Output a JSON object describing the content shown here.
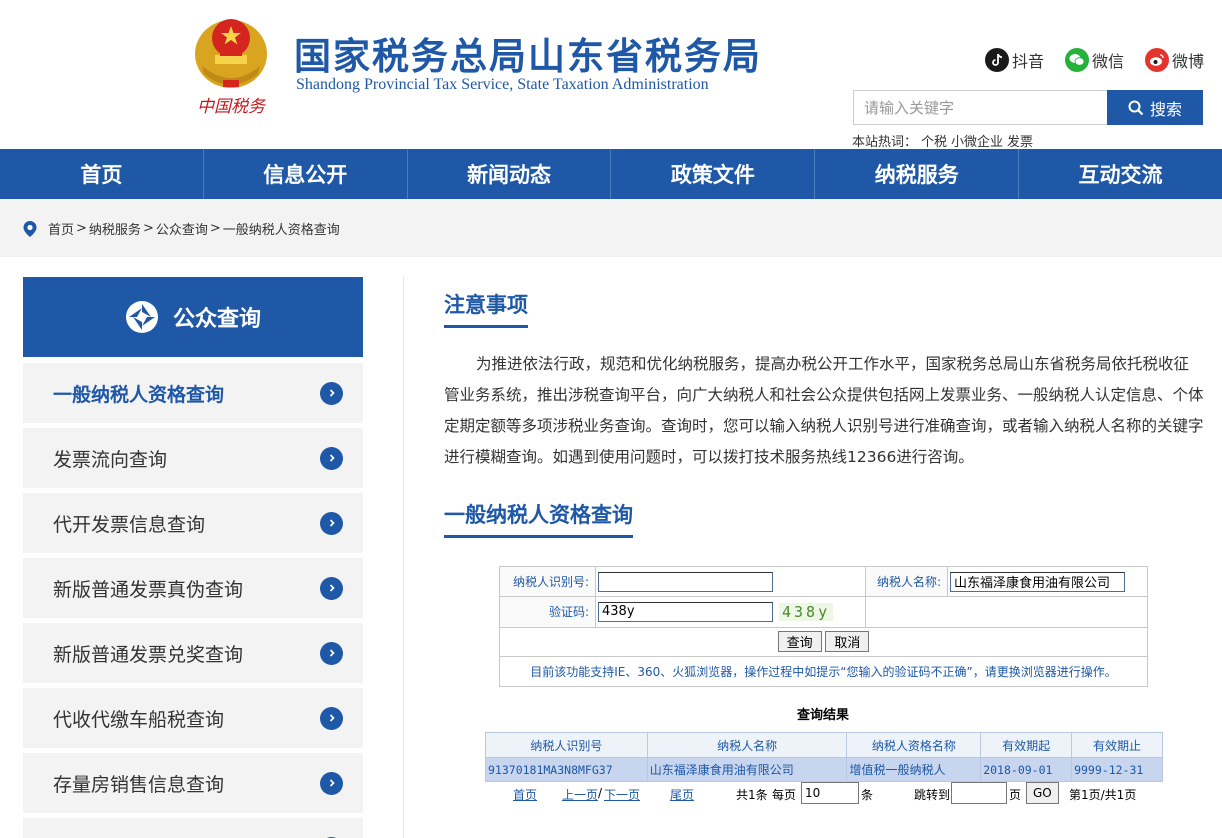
{
  "header": {
    "title": "国家税务总局山东省税务局",
    "subtitle": "Shandong Provincial Tax Service, State Taxation Administration",
    "logo_text": "中国税务",
    "social": [
      {
        "label": "抖音",
        "icon": "douyin-icon"
      },
      {
        "label": "微信",
        "icon": "wechat-icon"
      },
      {
        "label": "微博",
        "icon": "weibo-icon"
      }
    ],
    "search": {
      "placeholder": "请输入关键字",
      "button": "搜索"
    },
    "hot": {
      "label": "本站热词：",
      "keywords": [
        "个税",
        "小微企业",
        "发票"
      ]
    }
  },
  "nav": [
    "首页",
    "信息公开",
    "新闻动态",
    "政策文件",
    "纳税服务",
    "互动交流"
  ],
  "breadcrumb": {
    "items": [
      "首页",
      "纳税服务",
      "公众查询",
      "一般纳税人资格查询"
    ]
  },
  "sidebar": {
    "title": "公众查询",
    "items": [
      "一般纳税人资格查询",
      "发票流向查询",
      "代开发票信息查询",
      "新版普通发票真伪查询",
      "新版普通发票兑奖查询",
      "代收代缴车船税查询",
      "存量房销售信息查询",
      ""
    ],
    "active_index": 0
  },
  "notice": {
    "title": "注意事项",
    "body": "为推进依法行政，规范和优化纳税服务，提高办税公开工作水平，国家税务总局山东省税务局依托税收征管业务系统，推出涉税查询平台，向广大纳税人和社会公众提供包括网上发票业务、一般纳税人认定信息、个体定期定额等多项涉税业务查询。查询时，您可以输入纳税人识别号进行准确查询，或者输入纳税人名称的关键字进行模糊查询。如遇到使用问题时，可以拨打技术服务热线12366进行咨询。"
  },
  "query": {
    "title": "一般纳税人资格查询",
    "taxid_label": "纳税人识别号:",
    "taxid_value": "",
    "name_label": "纳税人名称:",
    "name_value": "山东福泽康食用油有限公司",
    "captcha_label": "验证码:",
    "captcha_value": "438y",
    "captcha_image_text": "438y",
    "search_btn": "查询",
    "cancel_btn": "取消",
    "tip": "目前该功能支持IE、360、火狐浏览器，操作过程中如提示“您输入的验证码不正确”，请更换浏览器进行操作。"
  },
  "results": {
    "caption": "查询结果",
    "columns": [
      "纳税人识别号",
      "纳税人名称",
      "纳税人资格名称",
      "有效期起",
      "有效期止"
    ],
    "rows": [
      [
        "91370181MA3N8MFG37",
        "山东福泽康食用油有限公司",
        "增值税一般纳税人",
        "2018-09-01",
        "9999-12-31"
      ]
    ]
  },
  "pager": {
    "first": "首页",
    "prev": "上一页",
    "slash": "/",
    "next": "下一页",
    "last": "尾页",
    "total": "共1条",
    "per_page_label": "每页",
    "per_page_value": "10",
    "per_page_unit": "条",
    "jump_label": "跳转到",
    "jump_value": "",
    "page_unit": "页",
    "go": "GO",
    "status": "第1页/共1页"
  },
  "colors": {
    "brand": "#1e58a6",
    "panel": "#f3f3f3",
    "row_highlight": "#c7d5ee"
  }
}
